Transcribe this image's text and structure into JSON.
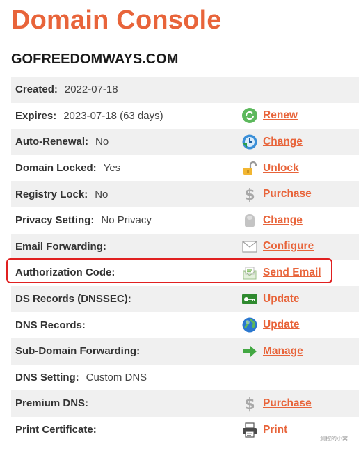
{
  "page": {
    "title": "Domain Console",
    "domain": "GOFREEDOMWAYS.COM"
  },
  "rows": [
    {
      "label": "Created:",
      "value": "2022-07-18",
      "action": null,
      "icon": null
    },
    {
      "label": "Expires:",
      "value": "2023-07-18 (63 days)",
      "action": "Renew",
      "icon": "renew-icon"
    },
    {
      "label": "Auto-Renewal:",
      "value": "No",
      "action": "Change",
      "icon": "clock-icon"
    },
    {
      "label": "Domain Locked:",
      "value": "Yes",
      "action": "Unlock",
      "icon": "padlock-icon"
    },
    {
      "label": "Registry Lock:",
      "value": "No",
      "action": "Purchase",
      "icon": "dollar-icon"
    },
    {
      "label": "Privacy Setting:",
      "value": "No Privacy",
      "action": "Change",
      "icon": "privacy-icon"
    },
    {
      "label": "Email Forwarding:",
      "value": "",
      "action": "Configure",
      "icon": "envelope-icon"
    },
    {
      "label": "Authorization Code:",
      "value": "",
      "action": "Send Email",
      "icon": "open-envelope-icon"
    },
    {
      "label": "DS Records (DNSSEC):",
      "value": "",
      "action": "Update",
      "icon": "key-icon"
    },
    {
      "label": "DNS Records:",
      "value": "",
      "action": "Update",
      "icon": "globe-icon"
    },
    {
      "label": "Sub-Domain Forwarding:",
      "value": "",
      "action": "Manage",
      "icon": "arrow-right-icon"
    },
    {
      "label": "DNS Setting:",
      "value": "Custom DNS",
      "action": null,
      "icon": null
    },
    {
      "label": "Premium DNS:",
      "value": "",
      "action": "Purchase",
      "icon": "dollar-icon"
    },
    {
      "label": "Print Certificate:",
      "value": "",
      "action": "Print",
      "icon": "printer-icon"
    }
  ],
  "watermark": "测控的小窝"
}
